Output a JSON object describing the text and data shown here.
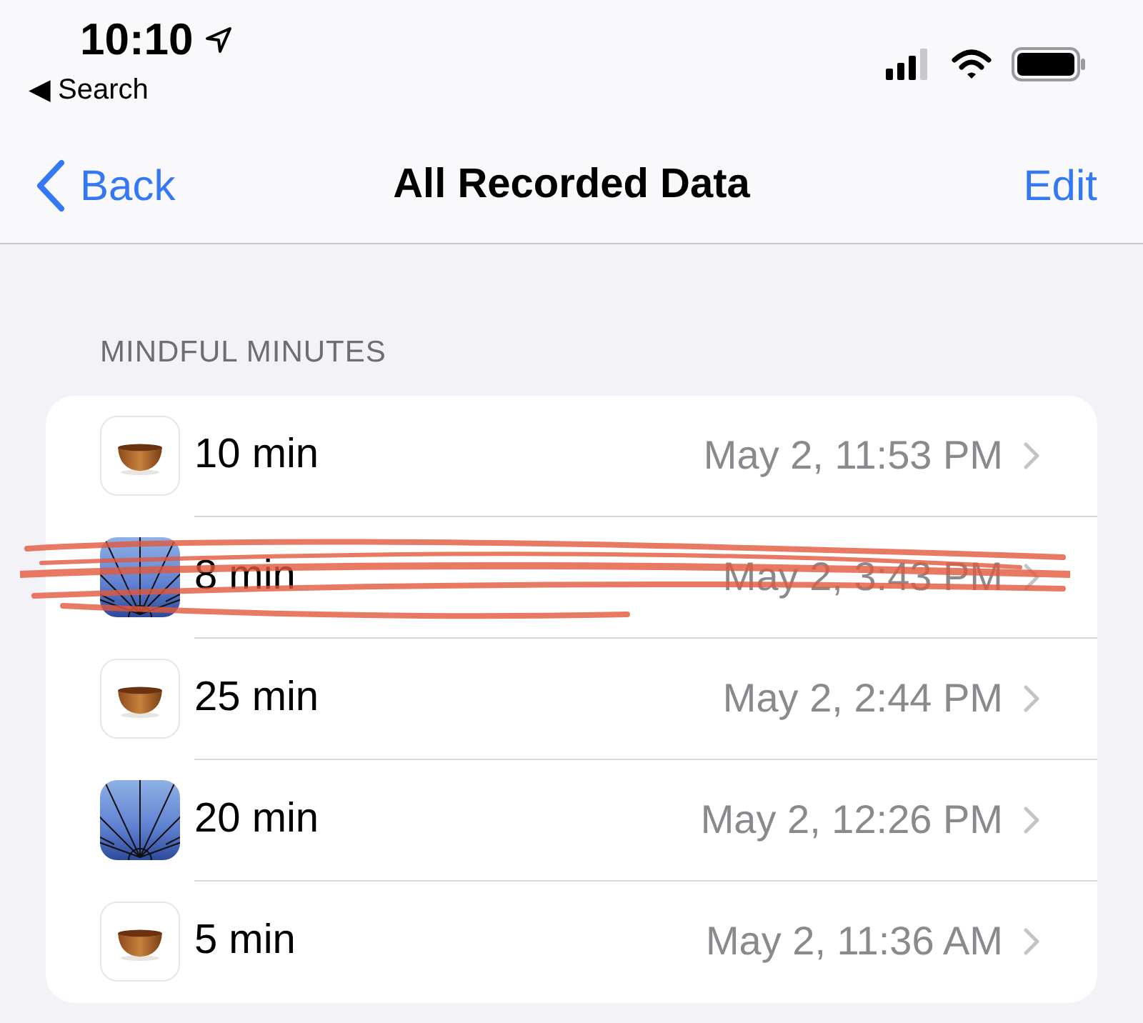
{
  "status_bar": {
    "time": "10:10",
    "back_label": "◀ Search"
  },
  "nav_bar": {
    "back": "Back",
    "title": "All Recorded Data",
    "action": "Edit"
  },
  "section": {
    "header": "MINDFUL MINUTES"
  },
  "rows": [
    {
      "kind": "bowl",
      "duration": "10 min",
      "date": "May 2, 11:53 PM",
      "scribbled": false
    },
    {
      "kind": "rays",
      "duration": "8 min",
      "date": "May 2, 3:43 PM",
      "scribbled": true
    },
    {
      "kind": "bowl",
      "duration": "25 min",
      "date": "May 2, 2:44 PM",
      "scribbled": false
    },
    {
      "kind": "rays",
      "duration": "20 min",
      "date": "May 2, 12:26 PM",
      "scribbled": false
    },
    {
      "kind": "bowl",
      "duration": "5 min",
      "date": "May 2, 11:36 AM",
      "scribbled": false
    }
  ]
}
